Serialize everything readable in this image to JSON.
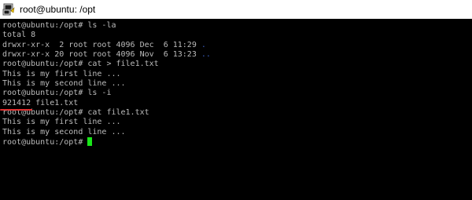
{
  "window": {
    "title": "root@ubuntu: /opt",
    "icon": "putty-terminal-icon"
  },
  "colors": {
    "background": "#000000",
    "text": "#bbbbbb",
    "directory": "#3b5fc4",
    "cursor": "#19e619",
    "annotation": "#e03030"
  },
  "terminal": {
    "lines": [
      "root@ubuntu:/opt# ls -la",
      "total 8",
      {
        "perms": "drwxr-xr-x  2 root root 4096 Dec  6 11:29 ",
        "name": "."
      },
      {
        "perms": "drwxr-xr-x 20 root root 4096 Nov  6 13:23 ",
        "name": ".."
      },
      "root@ubuntu:/opt# cat > file1.txt",
      "This is my first line ...",
      "This is my second line ...",
      "root@ubuntu:/opt# ls -i",
      {
        "inode": "921412",
        "file": " file1.txt"
      },
      "root@ubuntu:/opt# cat file1.txt",
      "This is my first line ...",
      "This is my second line ...",
      "root@ubuntu:/opt# "
    ]
  }
}
